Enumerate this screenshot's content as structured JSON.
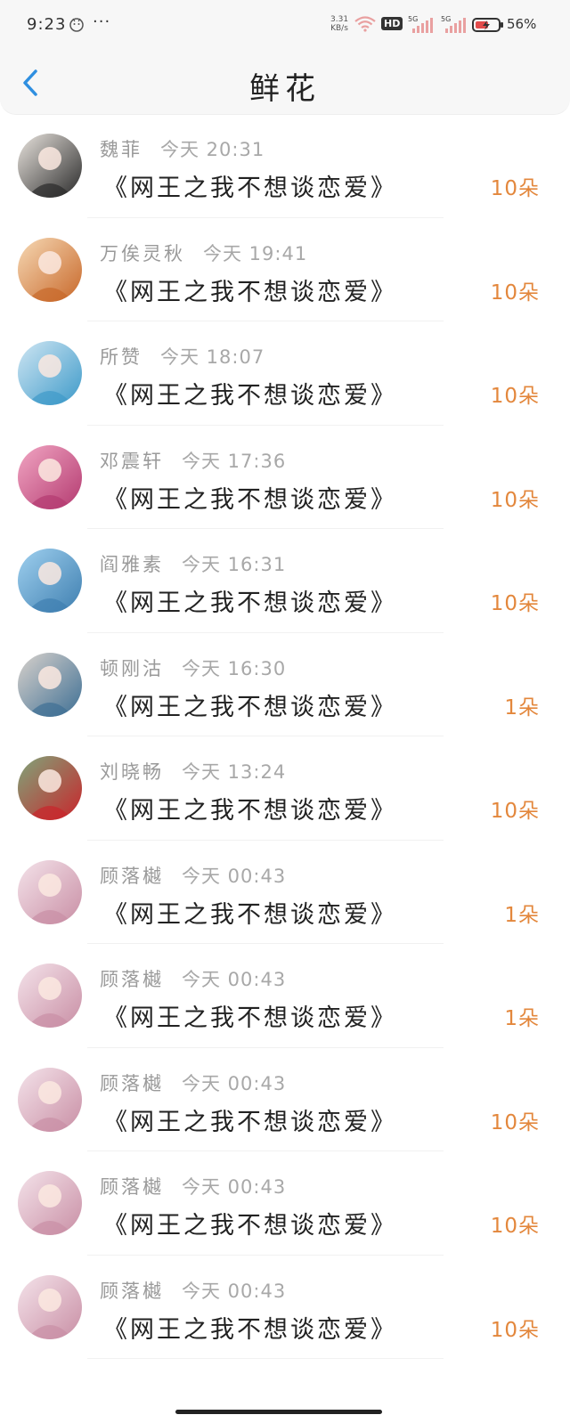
{
  "status_bar": {
    "time": "9:23",
    "dots": "···",
    "net_speed_value": "3.31",
    "net_speed_unit": "KB/s",
    "hd_badge": "HD",
    "signal_1_label": "5G",
    "signal_2_label": "5G",
    "battery_percent": "56%"
  },
  "header": {
    "title": "鲜花",
    "back_icon": "chevron-left-icon"
  },
  "colors": {
    "back_accent": "#2f8fe0",
    "count_color": "#e3873c",
    "meta_color": "#9a9a9a"
  },
  "rows": [
    {
      "name": "魏菲",
      "time": "今天 20:31",
      "book": "《网王之我不想谈恋爱》",
      "count": "10朵",
      "avatar_colors": [
        "#e9e4de",
        "#2a2a2a"
      ]
    },
    {
      "name": "万俟灵秋",
      "time": "今天 19:41",
      "book": "《网王之我不想谈恋爱》",
      "count": "10朵",
      "avatar_colors": [
        "#f6d9b5",
        "#c8682a"
      ]
    },
    {
      "name": "所赞",
      "time": "今天 18:07",
      "book": "《网王之我不想谈恋爱》",
      "count": "10朵",
      "avatar_colors": [
        "#cfe6f3",
        "#3e9ac9"
      ]
    },
    {
      "name": "邓震轩",
      "time": "今天 17:36",
      "book": "《网王之我不想谈恋爱》",
      "count": "10朵",
      "avatar_colors": [
        "#f1a6c3",
        "#b43a70"
      ]
    },
    {
      "name": "阎雅素",
      "time": "今天 16:31",
      "book": "《网王之我不想谈恋爱》",
      "count": "10朵",
      "avatar_colors": [
        "#9fd0ef",
        "#3f7fb0"
      ]
    },
    {
      "name": "顿刚沽",
      "time": "今天 16:30",
      "book": "《网王之我不想谈恋爱》",
      "count": "1朵",
      "avatar_colors": [
        "#d9d2cc",
        "#3e6f94"
      ]
    },
    {
      "name": "刘晓畅",
      "time": "今天 13:24",
      "book": "《网王之我不想谈恋爱》",
      "count": "10朵",
      "avatar_colors": [
        "#7fa57a",
        "#c9252b"
      ]
    },
    {
      "name": "顾落樾",
      "time": "今天 00:43",
      "book": "《网王之我不想谈恋爱》",
      "count": "1朵",
      "avatar_colors": [
        "#f4e3ea",
        "#c98fa5"
      ]
    },
    {
      "name": "顾落樾",
      "time": "今天 00:43",
      "book": "《网王之我不想谈恋爱》",
      "count": "1朵",
      "avatar_colors": [
        "#f4e3ea",
        "#c98fa5"
      ]
    },
    {
      "name": "顾落樾",
      "time": "今天 00:43",
      "book": "《网王之我不想谈恋爱》",
      "count": "10朵",
      "avatar_colors": [
        "#f4e3ea",
        "#c98fa5"
      ]
    },
    {
      "name": "顾落樾",
      "time": "今天 00:43",
      "book": "《网王之我不想谈恋爱》",
      "count": "10朵",
      "avatar_colors": [
        "#f4e3ea",
        "#c98fa5"
      ]
    },
    {
      "name": "顾落樾",
      "time": "今天 00:43",
      "book": "《网王之我不想谈恋爱》",
      "count": "10朵",
      "avatar_colors": [
        "#f4e3ea",
        "#c98fa5"
      ]
    }
  ]
}
